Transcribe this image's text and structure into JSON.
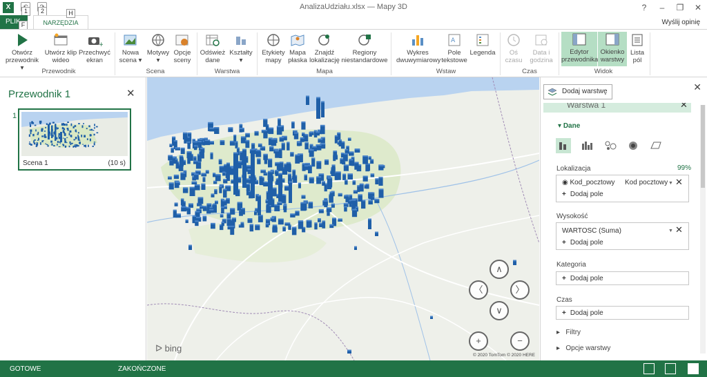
{
  "window": {
    "title": "AnalizaUdziału.xlsx — Mapy 3D",
    "minimize": "–",
    "restore": "❐",
    "close": "✕",
    "help": "?"
  },
  "quick_access": {
    "undo_key": "1",
    "redo_key": "2",
    "file_key": "F",
    "home_key": "H"
  },
  "tabs": {
    "file": "PLIK",
    "home": "NARZĘDZIA GŁÓWNE"
  },
  "feedback": "Wyślij opinię",
  "ribbon": {
    "przewodnik": {
      "open": "Otwórz przewodnik ▾",
      "video": "Utwórz klip wideo",
      "capture": "Przechwyć ekran",
      "group": "Przewodnik"
    },
    "scena": {
      "new": "Nowa scena ▾",
      "themes": "Motywy ▾",
      "options": "Opcje sceny",
      "group": "Scena"
    },
    "warstwa": {
      "refresh": "Odśwież dane",
      "shapes": "Kształty ▾",
      "group": "Warstwa"
    },
    "mapa": {
      "labels": "Etykiety mapy",
      "flat": "Mapa płaska",
      "find": "Znajdź lokalizację",
      "regions": "Regiony niestandardowe",
      "group": "Mapa"
    },
    "wstaw": {
      "chart2d": "Wykres dwuwymiarowy",
      "textbox": "Pole tekstowe",
      "legend": "Legenda",
      "group": "Wstaw"
    },
    "czas": {
      "timeline": "Oś czasu",
      "datetime": "Data i godzina",
      "group": "Czas"
    },
    "widok": {
      "editor": "Edytor przewodnika",
      "layer_pane": "Okienko warstwy",
      "field_list": "Lista pól",
      "group": "Widok"
    }
  },
  "left_panel": {
    "title": "Przewodnik 1",
    "close": "✕",
    "scene_index": "1",
    "scene_name": "Scena 1",
    "scene_duration": "(10 s)"
  },
  "map": {
    "bing": "bing",
    "copyright": "© 2020 TomTom © 2020 HERE",
    "nav": {
      "up": "∧",
      "down": "∨",
      "left": "〈",
      "right": "〉",
      "zoom_in": "+",
      "zoom_out": "−"
    }
  },
  "right_panel": {
    "close": "✕",
    "add_layer": "Dodaj warstwę",
    "layer_name": "Warstwa 1",
    "data_section": "Dane",
    "location": {
      "label": "Lokalizacja",
      "match_pct": "99%",
      "field": "Kod_pocztowy",
      "type": "Kod pocztowy",
      "add": "Dodaj pole"
    },
    "height": {
      "label": "Wysokość",
      "field": "WARTOSC (Suma)",
      "add": "Dodaj pole"
    },
    "category": {
      "label": "Kategoria",
      "add": "Dodaj pole"
    },
    "time": {
      "label": "Czas",
      "add": "Dodaj pole"
    },
    "filters": "Filtry",
    "layer_options": "Opcje warstwy"
  },
  "status": {
    "left": "GOTOWE",
    "middle": "ZAKOŃCZONE"
  },
  "colors": {
    "accent": "#217346",
    "bar": "#1f5fa8",
    "land": "#eef0ea",
    "sea": "#b9d3f0",
    "lowland": "#d9e8c4"
  }
}
